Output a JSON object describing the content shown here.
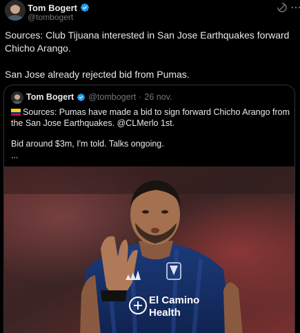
{
  "author": {
    "name": "Tom Bogert",
    "handle": "@tombogert"
  },
  "tweet": {
    "line1": "Sources: Club Tijuana interested in San Jose Earthquakes forward Chicho Arango.",
    "line2": "San Jose already rejected bid from Pumas."
  },
  "quote": {
    "name": "Tom Bogert",
    "handle": "@tombogert",
    "separator": "·",
    "date": "26 nov.",
    "line1": "Sources: Pumas have made a bid to sign forward Chicho Arango from the San Jose Earthquakes. @CLMerlo 1st.",
    "line2": "Bid around $3m, I'm told. Talks ongoing.",
    "line3": "...",
    "photo_sponsor": "El Camino Health"
  },
  "icons": {
    "verified": "verified-badge-icon",
    "grok": "grok-icon",
    "more": "more-options-icon",
    "flag": "colombia-flag-icon"
  },
  "colors": {
    "background": "#000000",
    "text": "#e7e9ea",
    "muted": "#71767b",
    "verified": "#1d9bf0",
    "border": "#2f3336"
  }
}
